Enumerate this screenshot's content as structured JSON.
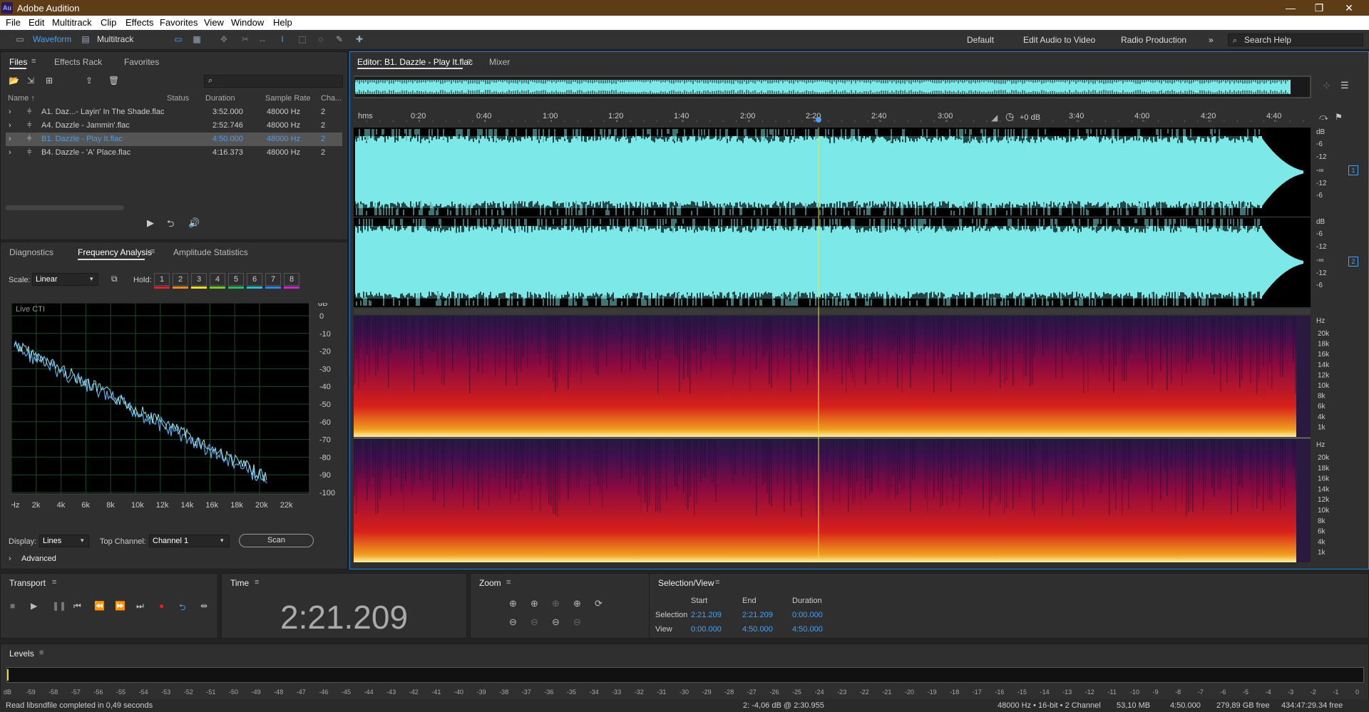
{
  "app": {
    "title": "Adobe Audition",
    "icon_label": "Au"
  },
  "menu": [
    "File",
    "Edit",
    "Multitrack",
    "Clip",
    "Effects",
    "Favorites",
    "View",
    "Window",
    "Help"
  ],
  "toolbar": {
    "waveform": "Waveform",
    "multitrack": "Multitrack",
    "workspaces": [
      "Default",
      "Edit Audio to Video",
      "Radio Production"
    ],
    "more": "»",
    "search_placeholder": "Search Help"
  },
  "files_panel": {
    "tabs": [
      "Files",
      "Effects Rack",
      "Favorites"
    ],
    "columns": [
      "Name ↑",
      "Status",
      "Duration",
      "Sample Rate",
      "Cha..."
    ],
    "rows": [
      {
        "name": "A1. Daz...- Layin' In The Shade.flac",
        "duration": "3:52.000",
        "rate": "48000 Hz",
        "ch": "2"
      },
      {
        "name": "A4. Dazzle - Jammin'.flac",
        "duration": "2:52.746",
        "rate": "48000 Hz",
        "ch": "2"
      },
      {
        "name": "B1. Dazzle - Play It.flac",
        "duration": "4:50.000",
        "rate": "48000 Hz",
        "ch": "2"
      },
      {
        "name": "B4. Dazzle - 'A' Place.flac",
        "duration": "4:16.373",
        "rate": "48000 Hz",
        "ch": "2"
      }
    ]
  },
  "analysis_panel": {
    "tabs": [
      "Diagnostics",
      "Frequency Analysis",
      "Amplitude Statistics"
    ],
    "scale_label": "Scale:",
    "scale_value": "Linear",
    "hold_label": "Hold:",
    "holds": [
      "1",
      "2",
      "3",
      "4",
      "5",
      "6",
      "7",
      "8"
    ],
    "hold_colors": [
      "#e0202a",
      "#f08a10",
      "#f0e020",
      "#70d020",
      "#20c060",
      "#20c0d0",
      "#3080f0",
      "#d020d0"
    ],
    "live_label": "Live CTI",
    "db_label": "dB",
    "db_ticks": [
      "0",
      "-10",
      "-20",
      "-30",
      "-40",
      "-50",
      "-60",
      "-70",
      "-80",
      "-90",
      "-100"
    ],
    "hz_ticks": [
      "Hz",
      "2k",
      "4k",
      "6k",
      "8k",
      "10k",
      "12k",
      "14k",
      "16k",
      "18k",
      "20k",
      "22k"
    ],
    "display_label": "Display:",
    "display_value": "Lines",
    "top_channel_label": "Top Channel:",
    "top_channel_value": "Channel 1",
    "scan": "Scan",
    "advanced": "Advanced"
  },
  "editor": {
    "tab": "Editor: B1. Dazzle - Play It.flac",
    "mixer": "Mixer",
    "timeline_unit": "hms",
    "ticks": [
      "0:20",
      "0:40",
      "1:00",
      "1:20",
      "1:40",
      "2:00",
      "2:20",
      "2:40",
      "3:00",
      "3:40",
      "4:00",
      "4:20",
      "4:40"
    ],
    "gain": "+0 dB",
    "amp_ticks": [
      "dB",
      "-6",
      "-12",
      "-∞",
      "-12",
      "-6"
    ],
    "channels": [
      "1",
      "2"
    ],
    "hz_label": "Hz",
    "spec_ticks": [
      "20k",
      "18k",
      "16k",
      "14k",
      "12k",
      "10k",
      "8k",
      "6k",
      "4k",
      "1k"
    ],
    "waveform_color": "#7ce8e8",
    "playhead_color": "#e8e840"
  },
  "transport": {
    "title": "Transport"
  },
  "time": {
    "title": "Time",
    "value": "2:21.209"
  },
  "zoom": {
    "title": "Zoom"
  },
  "selection": {
    "title": "Selection/View",
    "headers": [
      "Start",
      "End",
      "Duration"
    ],
    "selection_label": "Selection",
    "view_label": "View",
    "selection": [
      "2:21.209",
      "2:21.209",
      "0:00.000"
    ],
    "view": [
      "0:00.000",
      "4:50.000",
      "4:50.000"
    ]
  },
  "levels": {
    "title": "Levels",
    "ticks": [
      "dB",
      "-59",
      "-58",
      "-57",
      "-56",
      "-55",
      "-54",
      "-53",
      "-52",
      "-51",
      "-50",
      "-49",
      "-48",
      "-47",
      "-46",
      "-45",
      "-44",
      "-43",
      "-42",
      "-41",
      "-40",
      "-39",
      "-38",
      "-37",
      "-36",
      "-35",
      "-34",
      "-33",
      "-32",
      "-31",
      "-30",
      "-29",
      "-28",
      "-27",
      "-26",
      "-25",
      "-24",
      "-23",
      "-22",
      "-21",
      "-20",
      "-19",
      "-18",
      "-17",
      "-16",
      "-15",
      "-14",
      "-13",
      "-12",
      "-11",
      "-10",
      "-9",
      "-8",
      "-7",
      "-6",
      "-5",
      "-4",
      "-3",
      "-2",
      "-1",
      "0"
    ]
  },
  "status": {
    "left": "Read libsndfile completed in 0,49 seconds",
    "cursor": "2: -4,06 dB @ 2:30.955",
    "format": "48000 Hz • 16-bit • 2 Channel",
    "size": "53,10 MB",
    "duration": "4:50.000",
    "free": "279,89 GB free",
    "free_time": "434:47:29.34 free"
  }
}
